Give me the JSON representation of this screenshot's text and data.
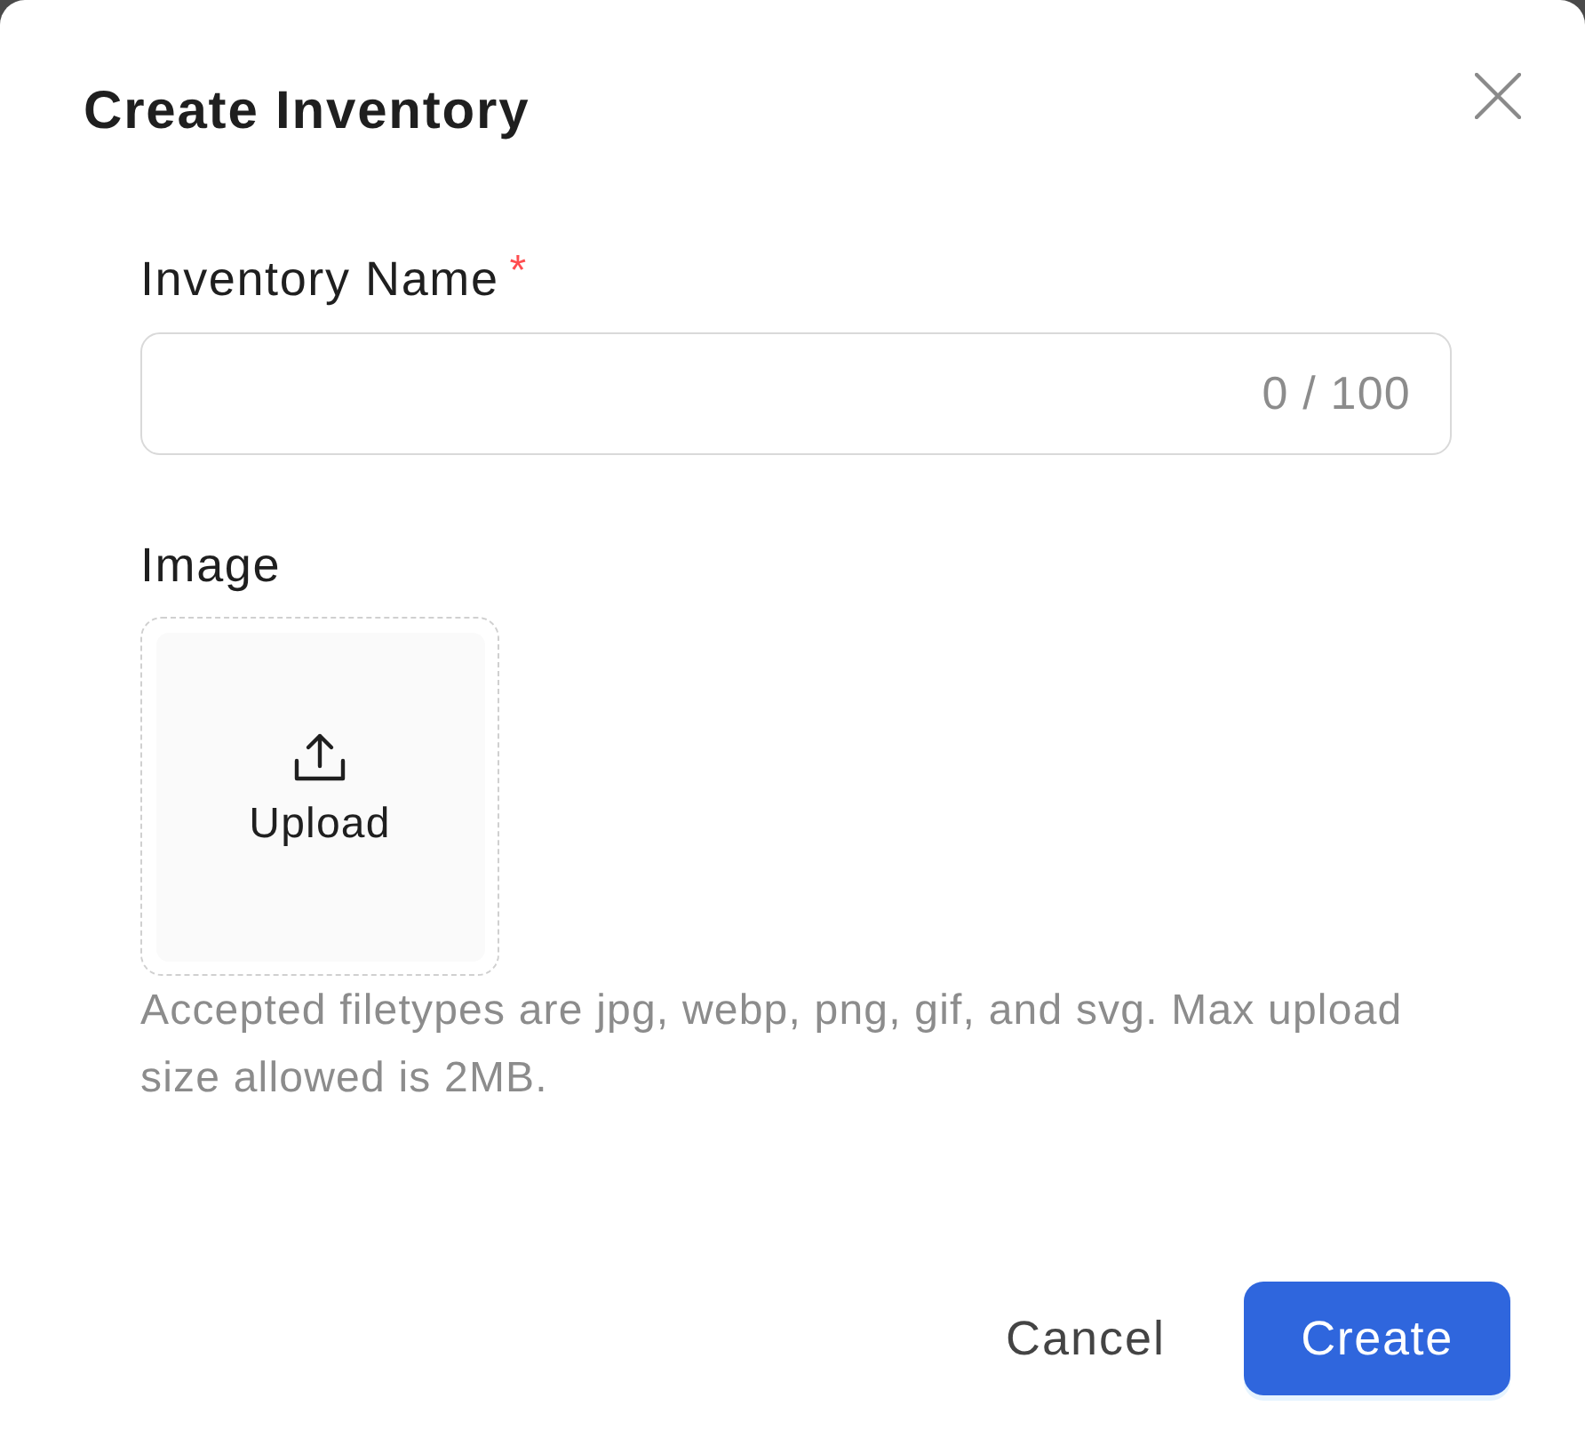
{
  "dialog": {
    "title": "Create Inventory"
  },
  "fields": [
    {
      "kind": "text",
      "label": "Inventory Name",
      "required_mark": "*",
      "counter": "0 / 100"
    },
    {
      "kind": "upload",
      "label": "Image",
      "upload_label": "Upload",
      "help": "Accepted filetypes are jpg, webp, png, gif, and svg. Max upload size allowed is 2MB."
    }
  ],
  "buttons": [
    {
      "kind": "secondary",
      "label": "Cancel"
    },
    {
      "kind": "primary",
      "label": "Create"
    }
  ]
}
